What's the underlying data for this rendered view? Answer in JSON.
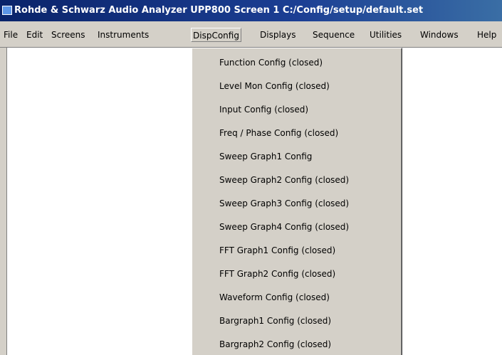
{
  "window": {
    "title": "Rohde & Schwarz Audio Analyzer UPP800 Screen 1  C:/Config/setup/default.set"
  },
  "menubar": {
    "items": [
      {
        "label": "File"
      },
      {
        "label": "Edit"
      },
      {
        "label": "Screens"
      },
      {
        "label": "Instruments"
      },
      {
        "label": "DispConfig"
      },
      {
        "label": "Displays"
      },
      {
        "label": "Sequence"
      },
      {
        "label": "Utilities"
      },
      {
        "label": "Windows"
      },
      {
        "label": "Help"
      }
    ],
    "active": "DispConfig"
  },
  "dispconfig_menu": {
    "items": [
      {
        "label": "Function Config (closed)"
      },
      {
        "label": "Level Mon Config (closed)"
      },
      {
        "label": "Input Config (closed)"
      },
      {
        "label": "Freq / Phase Config (closed)"
      },
      {
        "label": "Sweep Graph1 Config"
      },
      {
        "label": "Sweep Graph2 Config (closed)"
      },
      {
        "label": "Sweep Graph3 Config (closed)"
      },
      {
        "label": "Sweep Graph4 Config (closed)"
      },
      {
        "label": "FFT Graph1 Config (closed)"
      },
      {
        "label": "FFT Graph2 Config (closed)"
      },
      {
        "label": "Waveform Config (closed)"
      },
      {
        "label": "Bargraph1 Config (closed)"
      },
      {
        "label": "Bargraph2 Config (closed)"
      }
    ]
  },
  "colors": {
    "titlebar": "#0a246a",
    "menu_background": "#d4d0c8",
    "workspace": "#ffffff"
  },
  "icons": {
    "app_icon": "window-icon"
  }
}
